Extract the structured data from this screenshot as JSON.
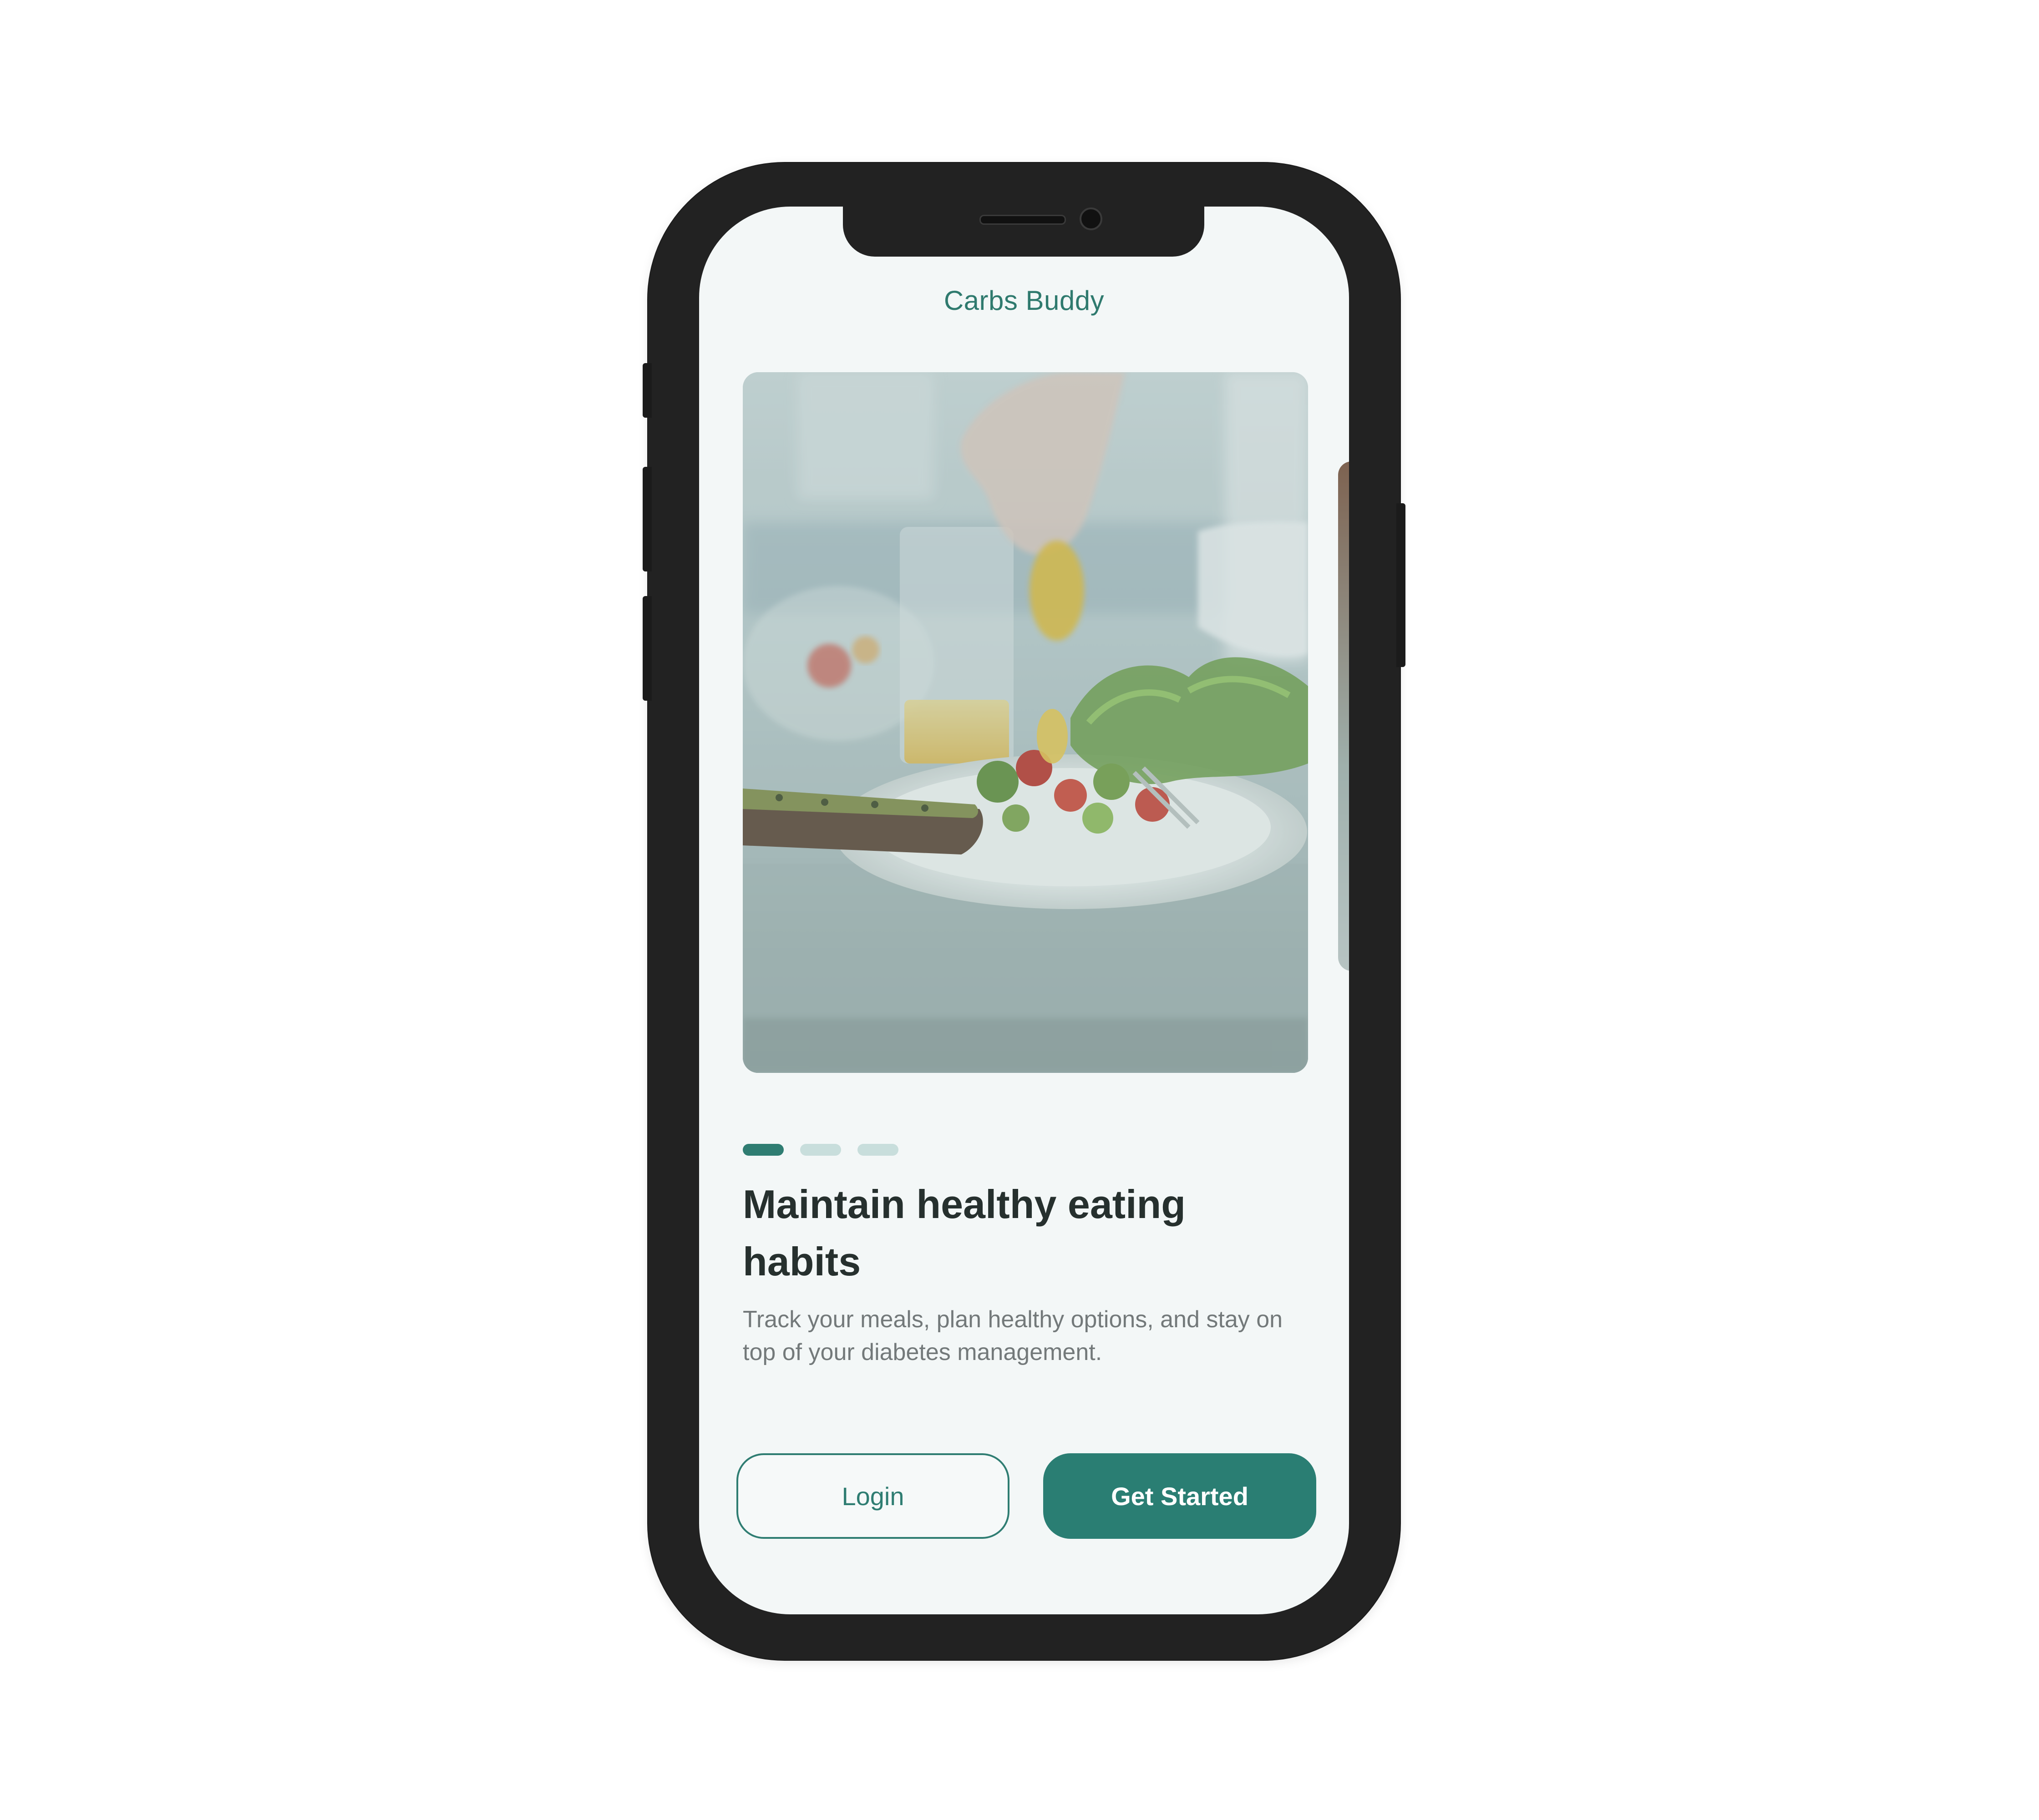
{
  "app": {
    "title": "Carbs Buddy"
  },
  "carousel": {
    "slides_total": 3,
    "active_index": 0,
    "image_semantic": "salad-plate-photo"
  },
  "onboarding": {
    "headline": "Maintain healthy eating habits",
    "description": "Track your meals, plan healthy options, and stay on top of your diabetes management."
  },
  "actions": {
    "login_label": "Login",
    "get_started_label": "Get Started"
  },
  "colors": {
    "brand": "#2a7e73",
    "screen_background": "#f3f7f7",
    "dot_inactive": "#c8dedc"
  }
}
